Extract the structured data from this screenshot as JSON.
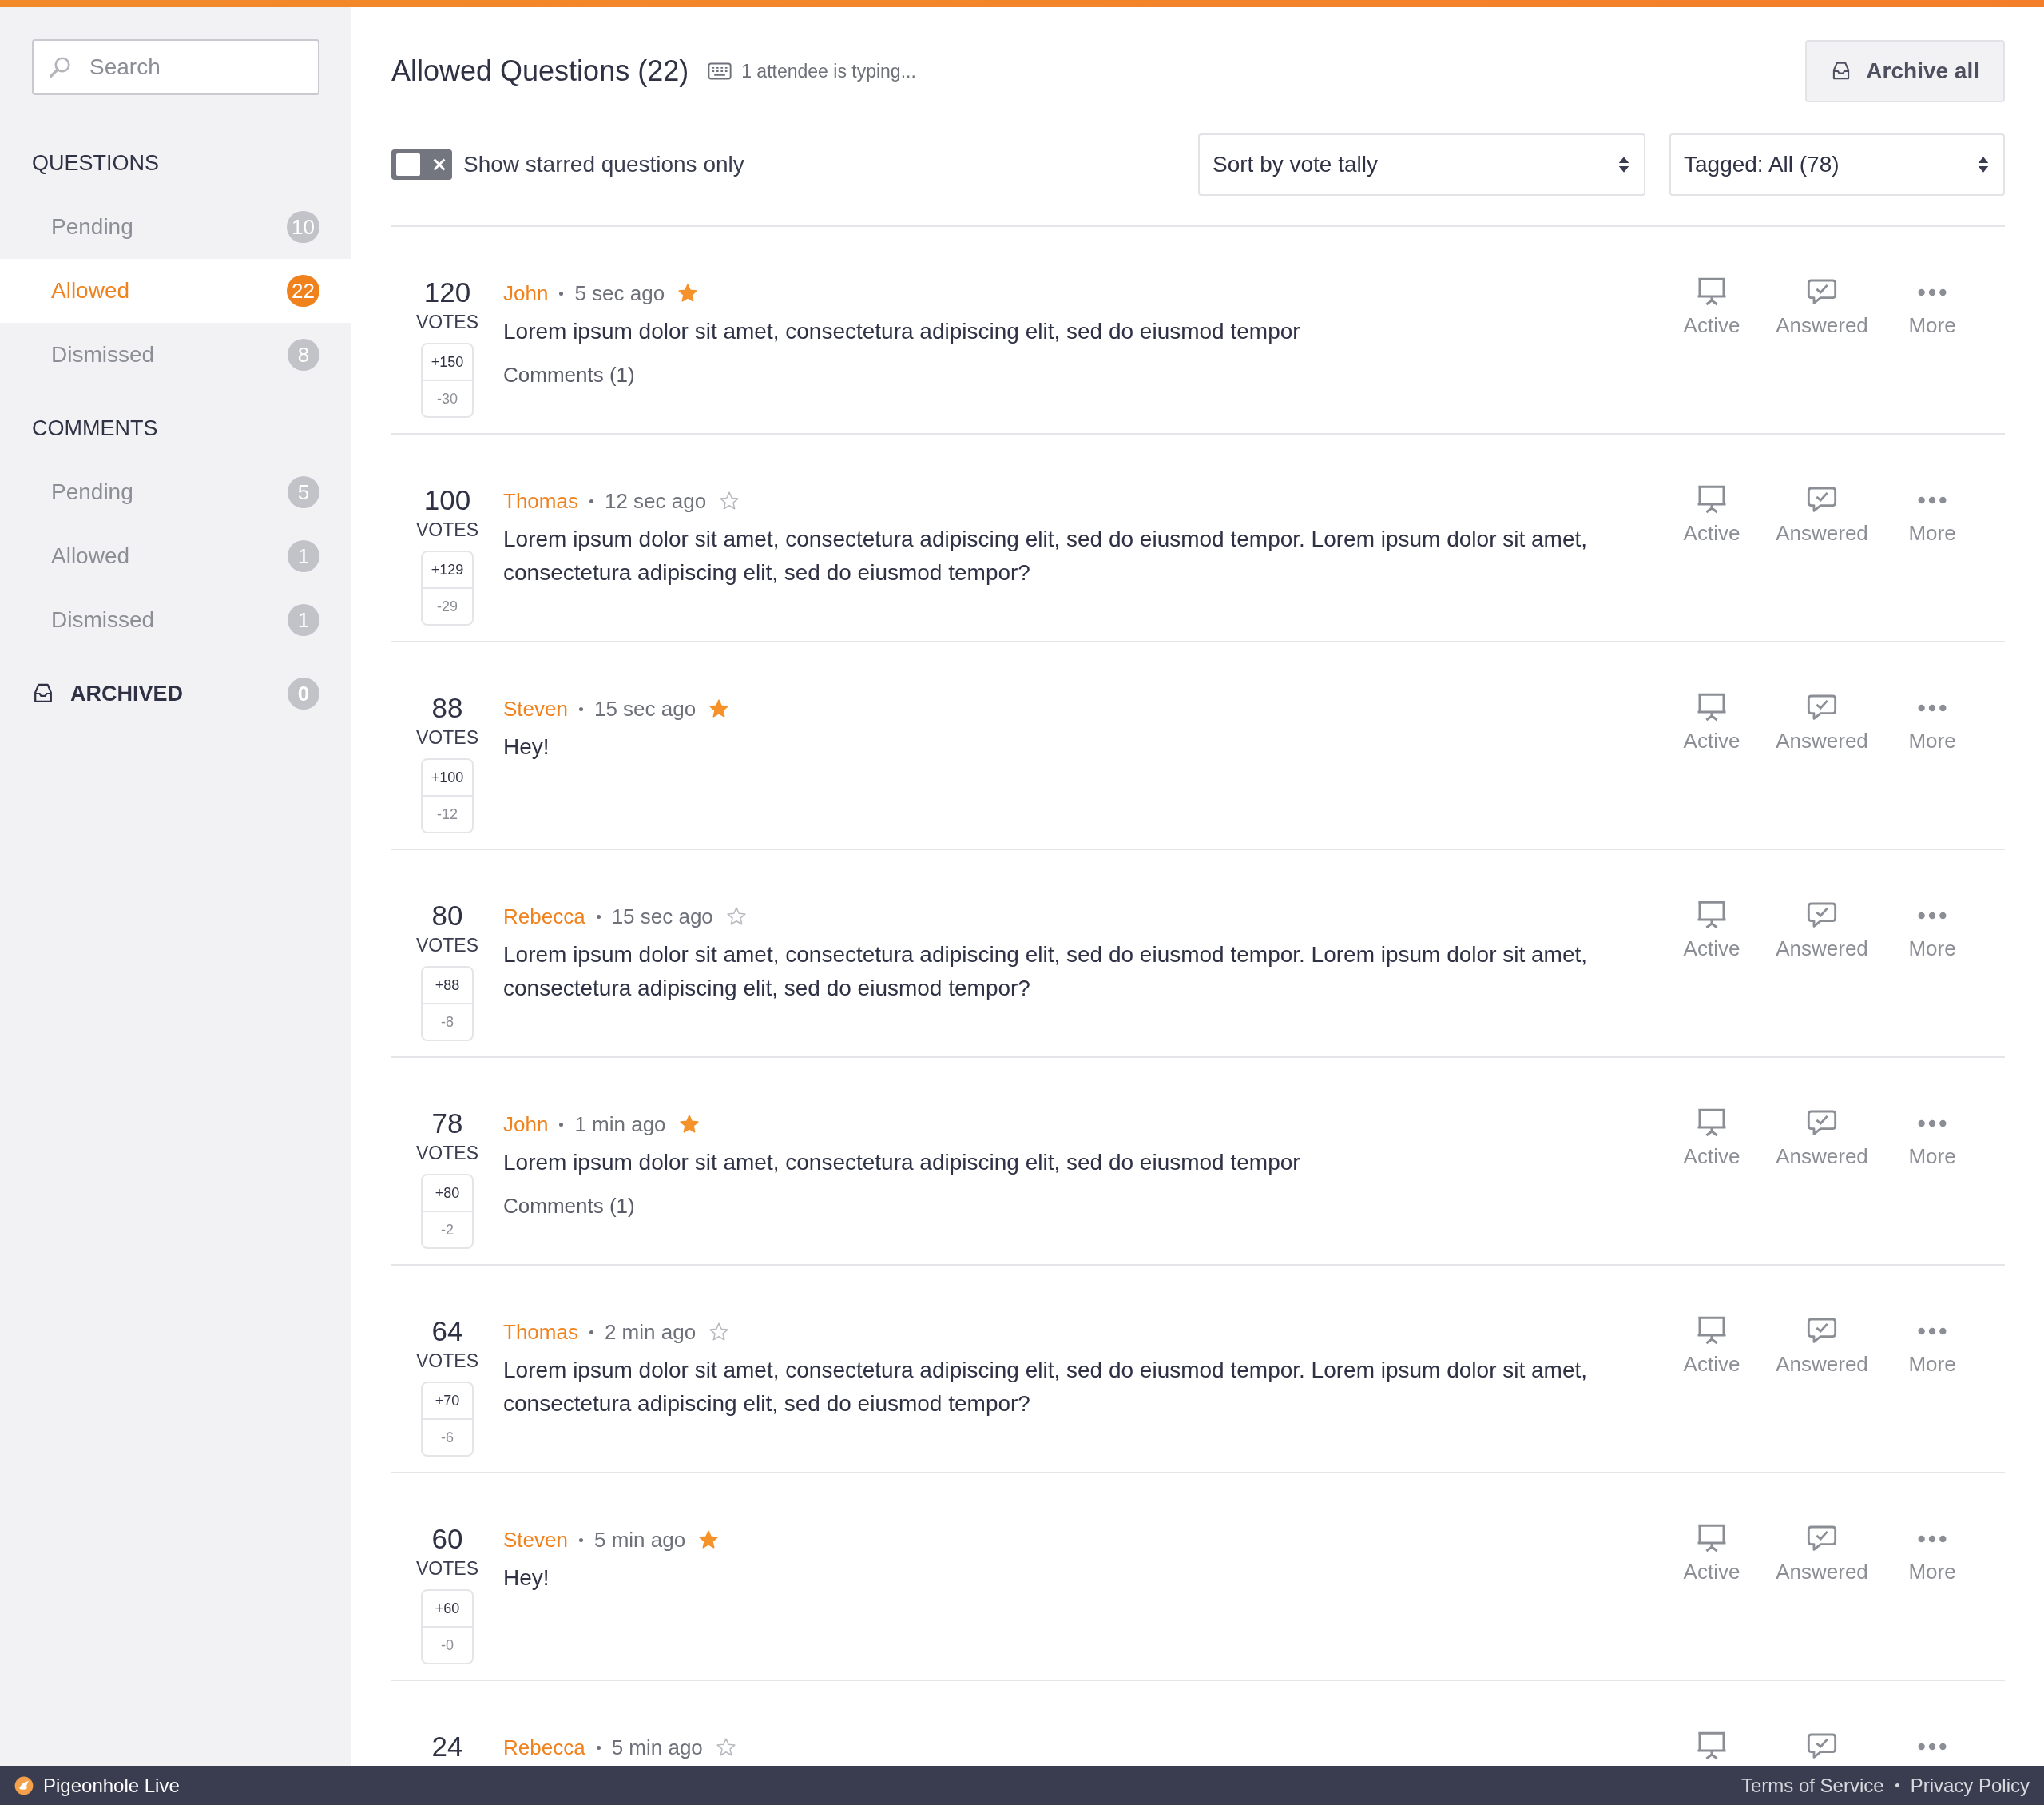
{
  "sidebar": {
    "search": {
      "placeholder": "Search"
    },
    "sections": [
      {
        "title": "QUESTIONS",
        "items": [
          {
            "label": "Pending",
            "count": "10",
            "selected": false
          },
          {
            "label": "Allowed",
            "count": "22",
            "selected": true
          },
          {
            "label": "Dismissed",
            "count": "8",
            "selected": false
          }
        ]
      },
      {
        "title": "COMMENTS",
        "items": [
          {
            "label": "Pending",
            "count": "5",
            "selected": false
          },
          {
            "label": "Allowed",
            "count": "1",
            "selected": false
          },
          {
            "label": "Dismissed",
            "count": "1",
            "selected": false
          }
        ]
      }
    ],
    "archived": {
      "label": "ARCHIVED",
      "count": "0"
    }
  },
  "header": {
    "title": "Allowed Questions (22)",
    "typing": "1 attendee is typing...",
    "archive_button": "Archive all"
  },
  "filters": {
    "starred_only": {
      "label": "Show starred questions only",
      "on": false
    },
    "sort": "Sort by vote tally",
    "tag": "Tagged: All (78)"
  },
  "questions": [
    {
      "votes": "120",
      "votes_label": "VOTES",
      "up": "+150",
      "down": "-30",
      "author": "John",
      "time": "5 sec ago",
      "starred": true,
      "text": "Lorem ipsum dolor sit amet, consectetura adipiscing elit, sed do eiusmod tempor",
      "comments": "Comments (1)",
      "actions": [
        {
          "kind": "active",
          "label": "Active"
        },
        {
          "kind": "answered",
          "label": "Answered"
        },
        {
          "kind": "more",
          "label": "More"
        }
      ]
    },
    {
      "votes": "100",
      "votes_label": "VOTES",
      "up": "+129",
      "down": "-29",
      "author": "Thomas",
      "time": "12 sec ago",
      "starred": false,
      "text": "Lorem ipsum dolor sit amet, consectetura adipiscing elit, sed do eiusmod tempor. Lorem ipsum dolor sit amet, consectetura adipiscing elit, sed do eiusmod tempor?",
      "actions": [
        {
          "kind": "active",
          "label": "Active"
        },
        {
          "kind": "answered",
          "label": "Answered"
        },
        {
          "kind": "more",
          "label": "More"
        }
      ]
    },
    {
      "votes": "88",
      "votes_label": "VOTES",
      "up": "+100",
      "down": "-12",
      "author": "Steven",
      "time": "15 sec ago",
      "starred": true,
      "text": "Hey!",
      "actions": [
        {
          "kind": "active",
          "label": "Active"
        },
        {
          "kind": "answered",
          "label": "Answered"
        },
        {
          "kind": "more",
          "label": "More"
        }
      ]
    },
    {
      "votes": "80",
      "votes_label": "VOTES",
      "up": "+88",
      "down": "-8",
      "author": "Rebecca",
      "time": "15 sec ago",
      "starred": false,
      "text": "Lorem ipsum dolor sit amet, consectetura adipiscing elit, sed do eiusmod tempor. Lorem ipsum dolor sit amet, consectetura adipiscing elit, sed do eiusmod tempor?",
      "actions": [
        {
          "kind": "active",
          "label": "Active"
        },
        {
          "kind": "answered",
          "label": "Answered"
        },
        {
          "kind": "more",
          "label": "More"
        }
      ]
    },
    {
      "votes": "78",
      "votes_label": "VOTES",
      "up": "+80",
      "down": "-2",
      "author": "John",
      "time": "1 min ago",
      "starred": true,
      "text": "Lorem ipsum dolor sit amet, consectetura adipiscing elit, sed do eiusmod tempor",
      "comments": "Comments (1)",
      "actions": [
        {
          "kind": "active",
          "label": "Active"
        },
        {
          "kind": "answered",
          "label": "Answered"
        },
        {
          "kind": "more",
          "label": "More"
        }
      ]
    },
    {
      "votes": "64",
      "votes_label": "VOTES",
      "up": "+70",
      "down": "-6",
      "author": "Thomas",
      "time": "2 min ago",
      "starred": false,
      "text": "Lorem ipsum dolor sit amet, consectetura adipiscing elit, sed do eiusmod tempor. Lorem ipsum dolor sit amet, consectetura adipiscing elit, sed do eiusmod tempor?",
      "actions": [
        {
          "kind": "active",
          "label": "Active"
        },
        {
          "kind": "answered",
          "label": "Answered"
        },
        {
          "kind": "more",
          "label": "More"
        }
      ]
    },
    {
      "votes": "60",
      "votes_label": "VOTES",
      "up": "+60",
      "down": "-0",
      "author": "Steven",
      "time": "5 min ago",
      "starred": true,
      "text": "Hey!",
      "actions": [
        {
          "kind": "active",
          "label": "Active"
        },
        {
          "kind": "answered",
          "label": "Answered"
        },
        {
          "kind": "more",
          "label": "More"
        }
      ]
    },
    {
      "votes": "24",
      "author": "Rebecca",
      "time": "5 min ago",
      "starred": false,
      "actions": [
        {
          "kind": "active"
        },
        {
          "kind": "answered"
        },
        {
          "kind": "more"
        }
      ]
    }
  ],
  "footer": {
    "brand": "Pigeonhole Live",
    "links": [
      "Terms of Service",
      "Privacy Policy"
    ]
  }
}
